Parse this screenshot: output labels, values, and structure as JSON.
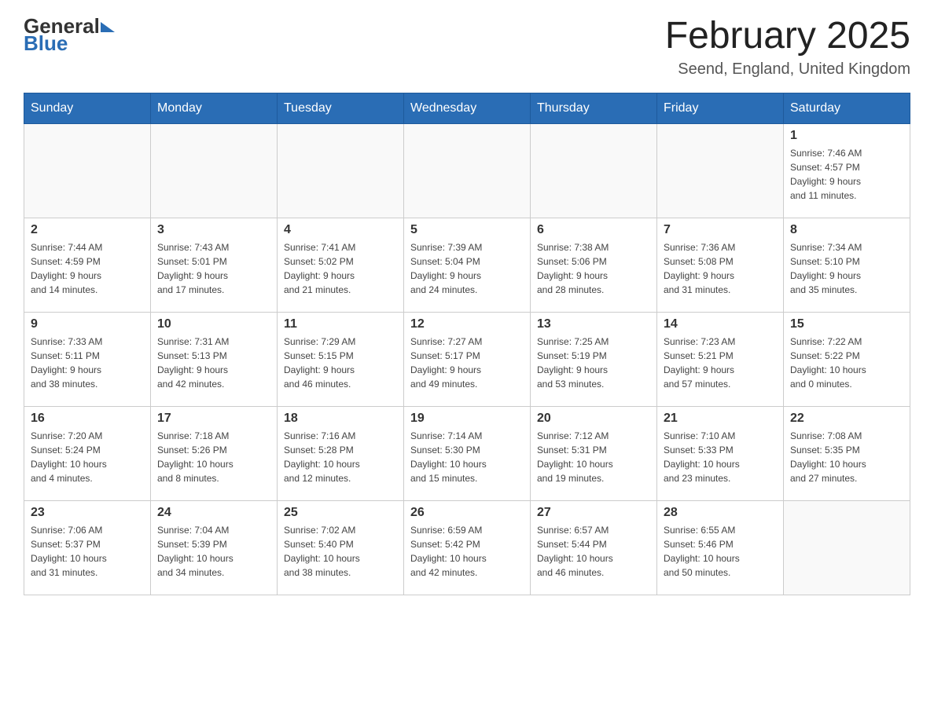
{
  "header": {
    "title": "February 2025",
    "subtitle": "Seend, England, United Kingdom",
    "logo_general": "General",
    "logo_blue": "Blue"
  },
  "days_of_week": [
    "Sunday",
    "Monday",
    "Tuesday",
    "Wednesday",
    "Thursday",
    "Friday",
    "Saturday"
  ],
  "weeks": [
    [
      {
        "day": "",
        "info": ""
      },
      {
        "day": "",
        "info": ""
      },
      {
        "day": "",
        "info": ""
      },
      {
        "day": "",
        "info": ""
      },
      {
        "day": "",
        "info": ""
      },
      {
        "day": "",
        "info": ""
      },
      {
        "day": "1",
        "info": "Sunrise: 7:46 AM\nSunset: 4:57 PM\nDaylight: 9 hours\nand 11 minutes."
      }
    ],
    [
      {
        "day": "2",
        "info": "Sunrise: 7:44 AM\nSunset: 4:59 PM\nDaylight: 9 hours\nand 14 minutes."
      },
      {
        "day": "3",
        "info": "Sunrise: 7:43 AM\nSunset: 5:01 PM\nDaylight: 9 hours\nand 17 minutes."
      },
      {
        "day": "4",
        "info": "Sunrise: 7:41 AM\nSunset: 5:02 PM\nDaylight: 9 hours\nand 21 minutes."
      },
      {
        "day": "5",
        "info": "Sunrise: 7:39 AM\nSunset: 5:04 PM\nDaylight: 9 hours\nand 24 minutes."
      },
      {
        "day": "6",
        "info": "Sunrise: 7:38 AM\nSunset: 5:06 PM\nDaylight: 9 hours\nand 28 minutes."
      },
      {
        "day": "7",
        "info": "Sunrise: 7:36 AM\nSunset: 5:08 PM\nDaylight: 9 hours\nand 31 minutes."
      },
      {
        "day": "8",
        "info": "Sunrise: 7:34 AM\nSunset: 5:10 PM\nDaylight: 9 hours\nand 35 minutes."
      }
    ],
    [
      {
        "day": "9",
        "info": "Sunrise: 7:33 AM\nSunset: 5:11 PM\nDaylight: 9 hours\nand 38 minutes."
      },
      {
        "day": "10",
        "info": "Sunrise: 7:31 AM\nSunset: 5:13 PM\nDaylight: 9 hours\nand 42 minutes."
      },
      {
        "day": "11",
        "info": "Sunrise: 7:29 AM\nSunset: 5:15 PM\nDaylight: 9 hours\nand 46 minutes."
      },
      {
        "day": "12",
        "info": "Sunrise: 7:27 AM\nSunset: 5:17 PM\nDaylight: 9 hours\nand 49 minutes."
      },
      {
        "day": "13",
        "info": "Sunrise: 7:25 AM\nSunset: 5:19 PM\nDaylight: 9 hours\nand 53 minutes."
      },
      {
        "day": "14",
        "info": "Sunrise: 7:23 AM\nSunset: 5:21 PM\nDaylight: 9 hours\nand 57 minutes."
      },
      {
        "day": "15",
        "info": "Sunrise: 7:22 AM\nSunset: 5:22 PM\nDaylight: 10 hours\nand 0 minutes."
      }
    ],
    [
      {
        "day": "16",
        "info": "Sunrise: 7:20 AM\nSunset: 5:24 PM\nDaylight: 10 hours\nand 4 minutes."
      },
      {
        "day": "17",
        "info": "Sunrise: 7:18 AM\nSunset: 5:26 PM\nDaylight: 10 hours\nand 8 minutes."
      },
      {
        "day": "18",
        "info": "Sunrise: 7:16 AM\nSunset: 5:28 PM\nDaylight: 10 hours\nand 12 minutes."
      },
      {
        "day": "19",
        "info": "Sunrise: 7:14 AM\nSunset: 5:30 PM\nDaylight: 10 hours\nand 15 minutes."
      },
      {
        "day": "20",
        "info": "Sunrise: 7:12 AM\nSunset: 5:31 PM\nDaylight: 10 hours\nand 19 minutes."
      },
      {
        "day": "21",
        "info": "Sunrise: 7:10 AM\nSunset: 5:33 PM\nDaylight: 10 hours\nand 23 minutes."
      },
      {
        "day": "22",
        "info": "Sunrise: 7:08 AM\nSunset: 5:35 PM\nDaylight: 10 hours\nand 27 minutes."
      }
    ],
    [
      {
        "day": "23",
        "info": "Sunrise: 7:06 AM\nSunset: 5:37 PM\nDaylight: 10 hours\nand 31 minutes."
      },
      {
        "day": "24",
        "info": "Sunrise: 7:04 AM\nSunset: 5:39 PM\nDaylight: 10 hours\nand 34 minutes."
      },
      {
        "day": "25",
        "info": "Sunrise: 7:02 AM\nSunset: 5:40 PM\nDaylight: 10 hours\nand 38 minutes."
      },
      {
        "day": "26",
        "info": "Sunrise: 6:59 AM\nSunset: 5:42 PM\nDaylight: 10 hours\nand 42 minutes."
      },
      {
        "day": "27",
        "info": "Sunrise: 6:57 AM\nSunset: 5:44 PM\nDaylight: 10 hours\nand 46 minutes."
      },
      {
        "day": "28",
        "info": "Sunrise: 6:55 AM\nSunset: 5:46 PM\nDaylight: 10 hours\nand 50 minutes."
      },
      {
        "day": "",
        "info": ""
      }
    ]
  ]
}
